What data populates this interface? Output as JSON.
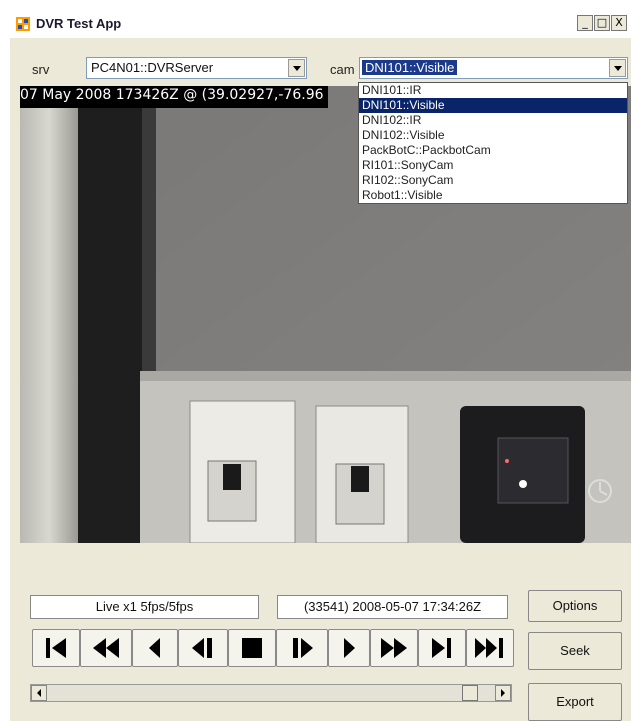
{
  "window": {
    "title": "DVR Test App",
    "minimize": "_",
    "maximize": "□",
    "close": "X"
  },
  "srv": {
    "label": "srv",
    "value": "PC4N01::DVRServer"
  },
  "cam": {
    "label": "cam",
    "value": "DNI101::Visible",
    "options": [
      "DNI101::IR",
      "DNI101::Visible",
      "DNI102::IR",
      "DNI102::Visible",
      "PackBotC::PackbotCam",
      "RI101::SonyCam",
      "RI102::SonyCam",
      "Robot1::Visible"
    ],
    "selected_index": 1
  },
  "video": {
    "overlay": "07 May 2008 173426Z @ (39.02927,-76.96"
  },
  "status": {
    "mode": "Live x1 5fps/5fps",
    "timestamp": "(33541) 2008-05-07 17:34:26Z"
  },
  "buttons": {
    "options": "Options",
    "seek": "Seek",
    "export": "Export"
  },
  "transport": [
    "skip-to-start",
    "fast-rewind",
    "rewind",
    "step-back",
    "stop",
    "step-forward",
    "play",
    "fast-forward",
    "skip-next",
    "skip-to-end"
  ],
  "scrollbar": {
    "position": 0.96
  }
}
